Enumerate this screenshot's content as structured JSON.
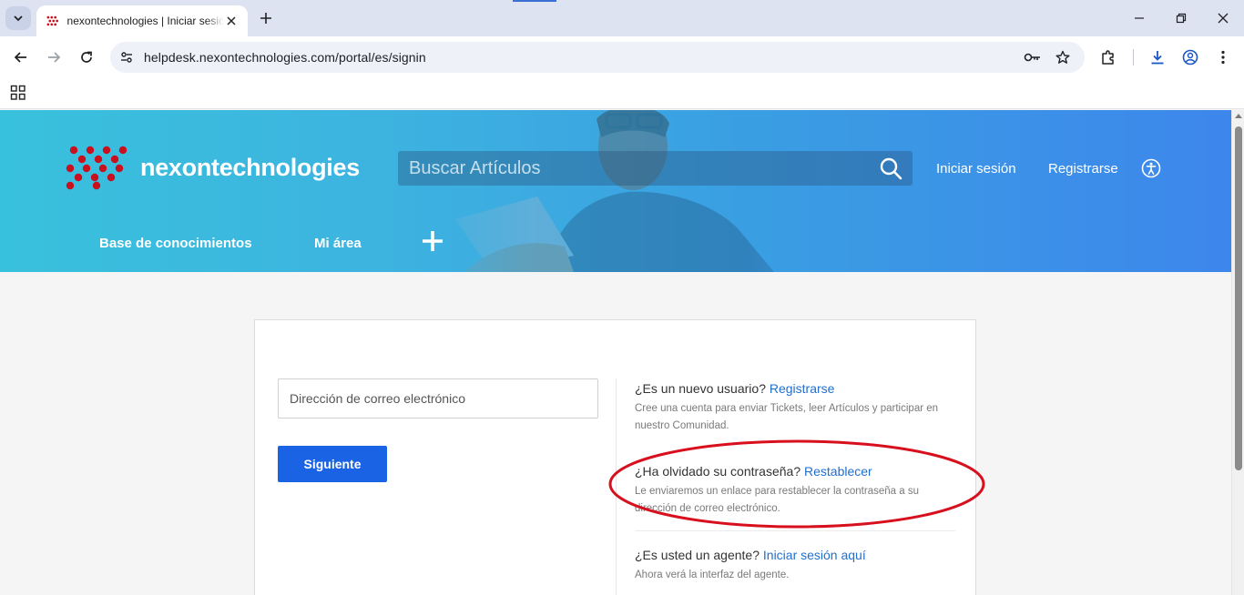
{
  "browser": {
    "tab_title": "nexontechnologies | Iniciar sesión",
    "url": "helpdesk.nexontechnologies.com/portal/es/signin"
  },
  "header": {
    "logo_text": "nexontechnologies",
    "search_placeholder": "Buscar Artículos",
    "sign_in": "Iniciar sesión",
    "register": "Registrarse"
  },
  "nav": {
    "items": [
      "Base de conocimientos",
      "Mi área"
    ]
  },
  "signin": {
    "email_placeholder": "Dirección de correo electrónico",
    "next_button": "Siguiente"
  },
  "side": {
    "new_user": {
      "question": "¿Es un nuevo usuario?",
      "link": "Registrarse",
      "description": "Cree una cuenta para enviar Tickets, leer Artículos y participar en nuestro Comunidad."
    },
    "forgot": {
      "question": "¿Ha olvidado su contraseña?",
      "link": "Restablecer",
      "description": "Le enviaremos un enlace para restablecer la contraseña a su dirección de correo electrónico."
    },
    "agent": {
      "question": "¿Es usted un agente?",
      "link": "Iniciar sesión aquí",
      "description": "Ahora verá la interfaz del agente."
    }
  },
  "colors": {
    "primary_button": "#1a63e4",
    "link": "#1f6fcf",
    "annotation": "#d8101e",
    "logo_dots": "#c8101e"
  }
}
